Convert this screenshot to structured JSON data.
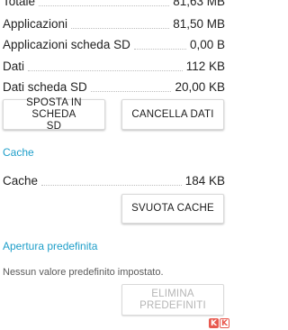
{
  "storage": {
    "rows": [
      {
        "label": "Totale",
        "value": "81,63 MB"
      },
      {
        "label": "Applicazioni",
        "value": "81,50 MB"
      },
      {
        "label": "Applicazioni scheda SD",
        "value": "0,00 B"
      },
      {
        "label": "Dati",
        "value": "112 KB"
      },
      {
        "label": "Dati scheda SD",
        "value": "20,00 KB"
      }
    ],
    "move_button_line1": "SPOSTA IN SCHEDA",
    "move_button_line2": "SD",
    "clear_data_button": "CANCELLA DATI"
  },
  "cache": {
    "section_title": "Cache",
    "row": {
      "label": "Cache",
      "value": "184 KB"
    },
    "clear_cache_button": "SVUOTA CACHE"
  },
  "defaults": {
    "section_title": "Apertura predefinita",
    "note": "Nessun valore predefinito impostato.",
    "clear_defaults_line1": "ELIMINA",
    "clear_defaults_line2": "PREDEFINITI"
  },
  "colors": {
    "accent": "#1e9ec9",
    "watermark": "#e8594f"
  }
}
